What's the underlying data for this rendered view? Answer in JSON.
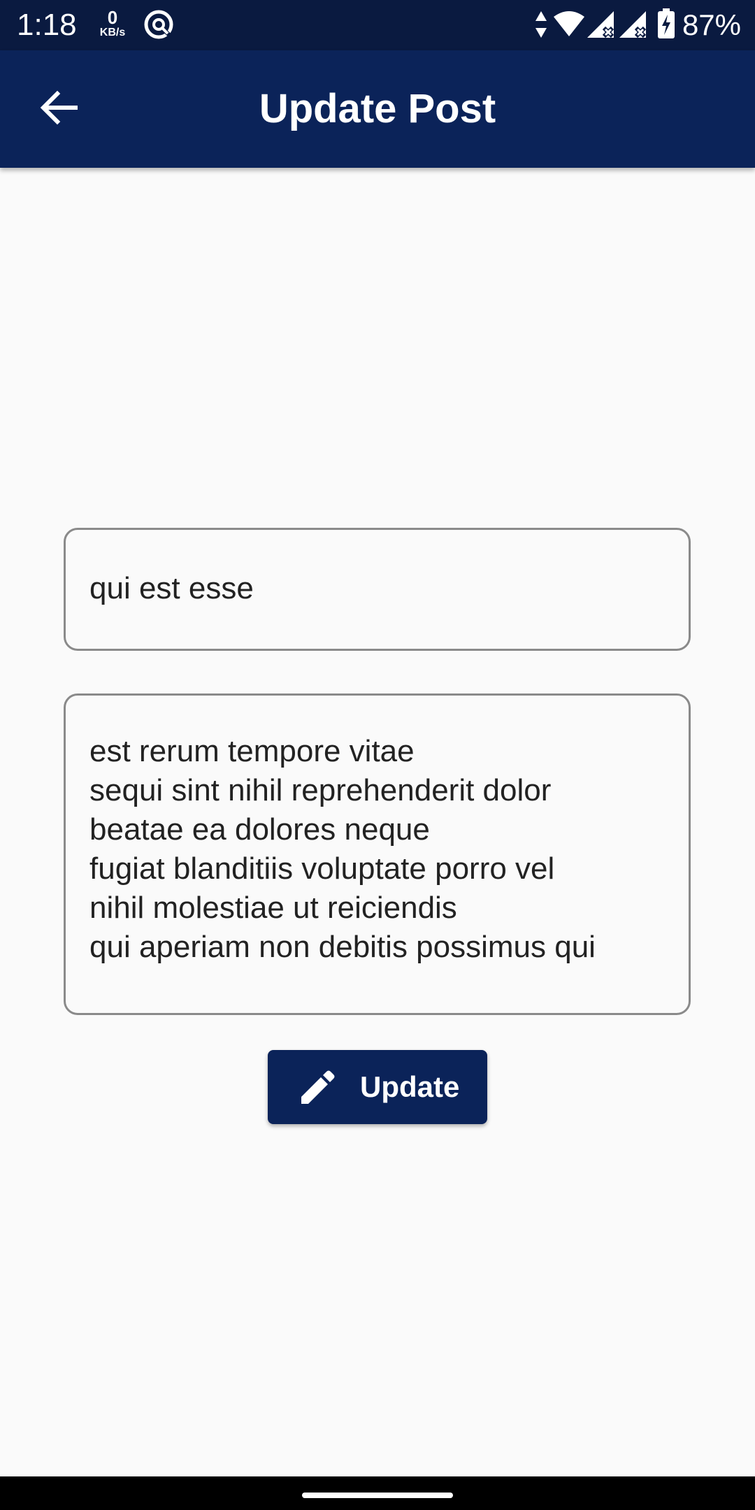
{
  "status_bar": {
    "time": "1:18",
    "net_speed_value": "0",
    "net_speed_unit": "KB/s",
    "battery_percent": "87%",
    "icons": [
      "sync-icon",
      "data-arrows-icon",
      "wifi-icon",
      "signal-icon",
      "signal-icon",
      "battery-charging-icon"
    ]
  },
  "app_bar": {
    "title": "Update Post",
    "back_icon": "arrow-back-icon",
    "background_color": "#0b2359"
  },
  "form": {
    "title_value": "qui est esse",
    "body_lines": [
      "est rerum tempore vitae",
      "sequi sint nihil reprehenderit dolor",
      "beatae ea dolores neque",
      "fugiat blanditiis voluptate porro vel",
      "nihil molestiae ut reiciendis",
      "qui aperiam non debitis possimus qui"
    ]
  },
  "update_button": {
    "label": "Update",
    "icon": "pencil-icon"
  },
  "colors": {
    "accent": "#0b2359",
    "status_bar": "#0a1a40",
    "background": "#fafafa"
  }
}
